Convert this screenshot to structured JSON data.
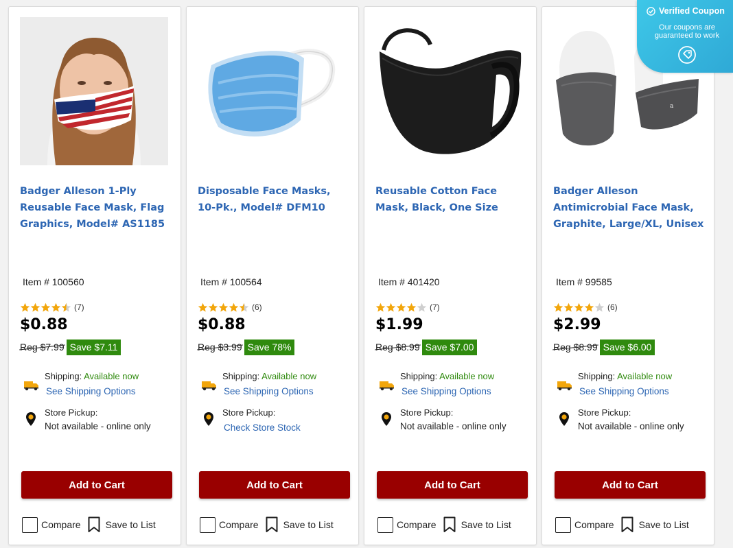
{
  "products": [
    {
      "title": "Badger Alleson 1-Ply Reusable Face Mask, Flag Graphics, Model# AS1185",
      "item_number": "Item # 100560",
      "rating": 4.5,
      "rating_count": "(7)",
      "price": "$0.88",
      "reg_price": "Reg $7.99",
      "save": "Save $7.11",
      "shipping_label": "Shipping: ",
      "shipping_status": "Available now",
      "shipping_link": "See Shipping Options",
      "pickup_label": "Store Pickup:",
      "pickup_status": "Not available - online only",
      "pickup_is_link": false,
      "add_to_cart": "Add to Cart",
      "compare": "Compare",
      "save_to_list": "Save to List",
      "image_icon": "flag-face-mask-model"
    },
    {
      "title": "Disposable Face Masks, 10-Pk., Model# DFM10",
      "item_number": "Item # 100564",
      "rating": 4.5,
      "rating_count": "(6)",
      "price": "$0.88",
      "reg_price": "Reg $3.99",
      "save": "Save 78%",
      "shipping_label": "Shipping: ",
      "shipping_status": "Available now",
      "shipping_link": "See Shipping Options",
      "pickup_label": "Store Pickup:",
      "pickup_status": "Check Store Stock",
      "pickup_is_link": true,
      "add_to_cart": "Add to Cart",
      "compare": "Compare",
      "save_to_list": "Save to List",
      "image_icon": "blue-disposable-mask"
    },
    {
      "title": "Reusable Cotton Face Mask, Black, One Size",
      "item_number": "Item # 401420",
      "rating": 4,
      "rating_count": "(7)",
      "price": "$1.99",
      "reg_price": "Reg $8.99",
      "save": "Save $7.00",
      "shipping_label": "Shipping: ",
      "shipping_status": "Available now",
      "shipping_link": "See Shipping Options",
      "pickup_label": "Store Pickup:",
      "pickup_status": "Not available - online only",
      "pickup_is_link": false,
      "add_to_cart": "Add to Cart",
      "compare": "Compare",
      "save_to_list": "Save to List",
      "image_icon": "black-cotton-mask"
    },
    {
      "title": "Badger Alleson Antimicrobial Face Mask, Graphite, Large/XL, Unisex",
      "item_number": "Item # 99585",
      "rating": 4,
      "rating_count": "(6)",
      "price": "$2.99",
      "reg_price": "Reg $8.99",
      "save": "Save $6.00",
      "shipping_label": "Shipping: ",
      "shipping_status": "Available now",
      "shipping_link": "See Shipping Options",
      "pickup_label": "Store Pickup:",
      "pickup_status": "Not available - online only",
      "pickup_is_link": false,
      "add_to_cart": "Add to Cart",
      "compare": "Compare",
      "save_to_list": "Save to List",
      "image_icon": "graphite-gaiter-mask"
    }
  ],
  "coupon_badge": {
    "title": "Verified Coupon",
    "message": "Our coupons are guaranteed to work",
    "icon": "coupon-tag-icon"
  },
  "colors": {
    "title_link": "#2d66b3",
    "available": "#2f8a0e",
    "save_badge": "#2f8a0e",
    "cart_button": "#990000",
    "star": "#f2a60c",
    "coupon": "#3ec7e8"
  }
}
